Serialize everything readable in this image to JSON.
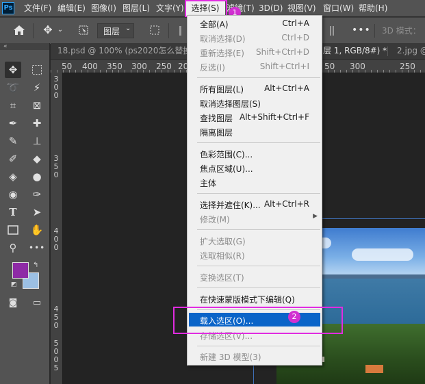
{
  "app": {
    "logo": "Ps"
  },
  "menubar": {
    "items": [
      "文件(F)",
      "编辑(E)",
      "图像(I)",
      "图层(L)",
      "文字(Y)",
      "选择(S)",
      "滤镜(T)",
      "3D(D)",
      "视图(V)",
      "窗口(W)",
      "帮助(H)"
    ]
  },
  "optionsbar": {
    "layer_select": "图层",
    "mode_label": "3D 模式："
  },
  "tabs": [
    {
      "label": "18.psd @ 100% (ps2020怎么替换图"
    },
    {
      "label": "层 1, RGB/8#) *"
    },
    {
      "label": "2.jpg @"
    }
  ],
  "ruler": {
    "ticks": [
      "50",
      "400",
      "350",
      "300",
      "250",
      "20"
    ],
    "ticks_right": [
      "50",
      "300",
      "250"
    ],
    "left_ticks": [
      "3",
      "0",
      "0",
      "3",
      "5",
      "0",
      "4",
      "0",
      "0",
      "4",
      "5",
      "0",
      "5",
      "0",
      "0",
      "5"
    ]
  },
  "colors": {
    "accent": "#0a64c8",
    "annotation": "#e12ce1",
    "foreground": "#8e2aa6",
    "background": "#9cc0e4"
  },
  "dropdown": {
    "groups": [
      [
        {
          "label": "全部(A)",
          "shortcut": "Ctrl+A",
          "enabled": true
        },
        {
          "label": "取消选择(D)",
          "shortcut": "Ctrl+D",
          "enabled": false
        },
        {
          "label": "重新选择(E)",
          "shortcut": "Shift+Ctrl+D",
          "enabled": false
        },
        {
          "label": "反选(I)",
          "shortcut": "Shift+Ctrl+I",
          "enabled": false
        }
      ],
      [
        {
          "label": "所有图层(L)",
          "shortcut": "Alt+Ctrl+A",
          "enabled": true
        },
        {
          "label": "取消选择图层(S)",
          "shortcut": "",
          "enabled": true
        },
        {
          "label": "查找图层",
          "shortcut": "Alt+Shift+Ctrl+F",
          "enabled": true
        },
        {
          "label": "隔离图层",
          "shortcut": "",
          "enabled": true
        }
      ],
      [
        {
          "label": "色彩范围(C)...",
          "shortcut": "",
          "enabled": true
        },
        {
          "label": "焦点区域(U)...",
          "shortcut": "",
          "enabled": true
        },
        {
          "label": "主体",
          "shortcut": "",
          "enabled": true
        }
      ],
      [
        {
          "label": "选择并遮住(K)...",
          "shortcut": "Alt+Ctrl+R",
          "enabled": true
        },
        {
          "label": "修改(M)",
          "shortcut": "",
          "enabled": false
        }
      ],
      [
        {
          "label": "扩大选取(G)",
          "shortcut": "",
          "enabled": false
        },
        {
          "label": "选取相似(R)",
          "shortcut": "",
          "enabled": false
        }
      ],
      [
        {
          "label": "变换选区(T)",
          "shortcut": "",
          "enabled": false
        }
      ],
      [
        {
          "label": "在快速蒙版模式下编辑(Q)",
          "shortcut": "",
          "enabled": true
        }
      ],
      [
        {
          "label": "载入选区(O)...",
          "shortcut": "",
          "enabled": true
        },
        {
          "label": "存储选区(V)...",
          "shortcut": "",
          "enabled": false
        }
      ],
      [
        {
          "label": "新建 3D 模型(3)",
          "shortcut": "",
          "enabled": false
        }
      ]
    ]
  },
  "annotations": {
    "badge1": "1",
    "badge2": "2"
  }
}
